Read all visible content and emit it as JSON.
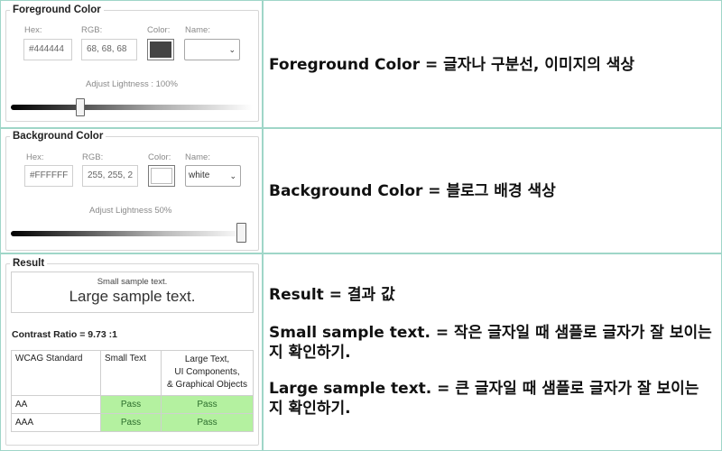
{
  "foreground": {
    "title": "Foreground Color",
    "hex_label": "Hex:",
    "hex_value": "#444444",
    "rgb_label": "RGB:",
    "rgb_value": "68, 68, 68",
    "color_label": "Color:",
    "name_label": "Name:",
    "name_value": "",
    "swatch_color": "#444444",
    "lightness_label": "Adjust Lightness : 100%",
    "lightness_percent": 100
  },
  "background": {
    "title": "Background Color",
    "hex_label": "Hex:",
    "hex_value": "#FFFFFF",
    "rgb_label": "RGB:",
    "rgb_value": "255, 255, 2",
    "color_label": "Color:",
    "name_label": "Name:",
    "name_value": "white",
    "swatch_color": "#FFFFFF",
    "lightness_label": "Adjust Lightness  50%",
    "lightness_percent": 50
  },
  "result": {
    "title": "Result",
    "small_sample": "Small sample text.",
    "large_sample": "Large sample text.",
    "contrast_ratio": "Contrast Ratio = 9.73 :1",
    "table": {
      "headers": [
        "WCAG Standard",
        "Small Text",
        "Large Text,\nUI Components,\n& Graphical Objects"
      ],
      "rows": [
        [
          "AA",
          "Pass",
          "Pass"
        ],
        [
          "AAA",
          "Pass",
          "Pass"
        ]
      ]
    }
  },
  "explanations": {
    "foreground": "Foreground Color = 글자나 구분선, 이미지의 색상",
    "background": "Background Color = 블로그 배경 색상",
    "result": "Result = 결과 값",
    "small": "Small sample text. = 작은 글자일 때 샘플로 글자가 잘 보이는 지 확인하기.",
    "large": "Large sample text. = 큰 글자일 때 샘플로 글자가 잘 보이는 지 확인하기."
  },
  "colors": {
    "border": "#9fd6c8",
    "pass": "#b4f1a0"
  }
}
